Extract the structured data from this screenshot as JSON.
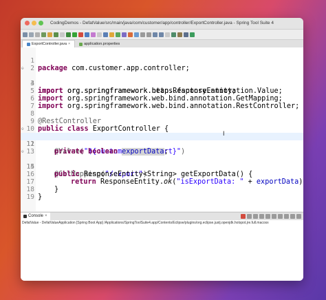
{
  "window": {
    "title": "CodingDemos - DefatValue/src/main/java/com/customer/app/controller/ExportController.java - Spring Tool Suite 4"
  },
  "tabs": [
    {
      "label": "ExportController.java",
      "active": true
    },
    {
      "label": "application.properties",
      "active": false
    }
  ],
  "editor": {
    "line_numbers": [
      "1",
      "2",
      "3",
      "4",
      "5",
      "6",
      "7",
      "8",
      "9",
      "10",
      "11",
      "12",
      "13",
      "14",
      "15",
      "16",
      "17",
      "18",
      "19"
    ],
    "code": {
      "l1_kw": "package",
      "l1_rest": " com.customer.app.controller;",
      "l3_kw": "import",
      "l3_rest": " org.springframework.beans.factory.annotation.Value;",
      "l4_kw": "import",
      "l4_rest": " org.springframework.http.ResponseEntity;",
      "l5_kw": "import",
      "l5_rest": " org.springframework.web.bind.annotation.GetMapping;",
      "l6_kw": "import",
      "l6_rest": " org.springframework.web.bind.annotation.RestController;",
      "l8_ann": "@RestController",
      "l9_kw": "public class",
      "l9_rest": " ExportController {",
      "l11_ann": "@Value(",
      "l11_str": "\"${custom.data.export}\"",
      "l11_end": ")",
      "l12_kw": "private boolean",
      "l12_space": " ",
      "l12_field": "exportData",
      "l12_end": ";",
      "l14_ann": "@GetMapping(",
      "l14_str": "\"/export\"",
      "l14_end": ")",
      "l15_kw": "public",
      "l15_rest": " ResponseEntity<String> getExportData() {",
      "l16_kw": "return",
      "l16_mid": " ResponseEntity.",
      "l16_ok": "ok",
      "l16_open": "(",
      "l16_str": "\"isExportData: \"",
      "l16_plus": " + ",
      "l16_field": "exportData",
      "l16_close": ")",
      "l17": "}",
      "l18": "}"
    }
  },
  "console": {
    "tab_label": "Console",
    "path": "DefatValue - DefatValueApplication [Spring Boot App] /Applications/SpringToolSuite4.app/Contents/Eclipse/plugins/org.eclipse.justj.openjdk.hotspot.jre.full.macosx"
  },
  "colors": {
    "keyword": "#7f0055",
    "string": "#2a00ff",
    "field": "#0000c0",
    "annotation": "#646464",
    "current_line": "#e8f2fe"
  }
}
